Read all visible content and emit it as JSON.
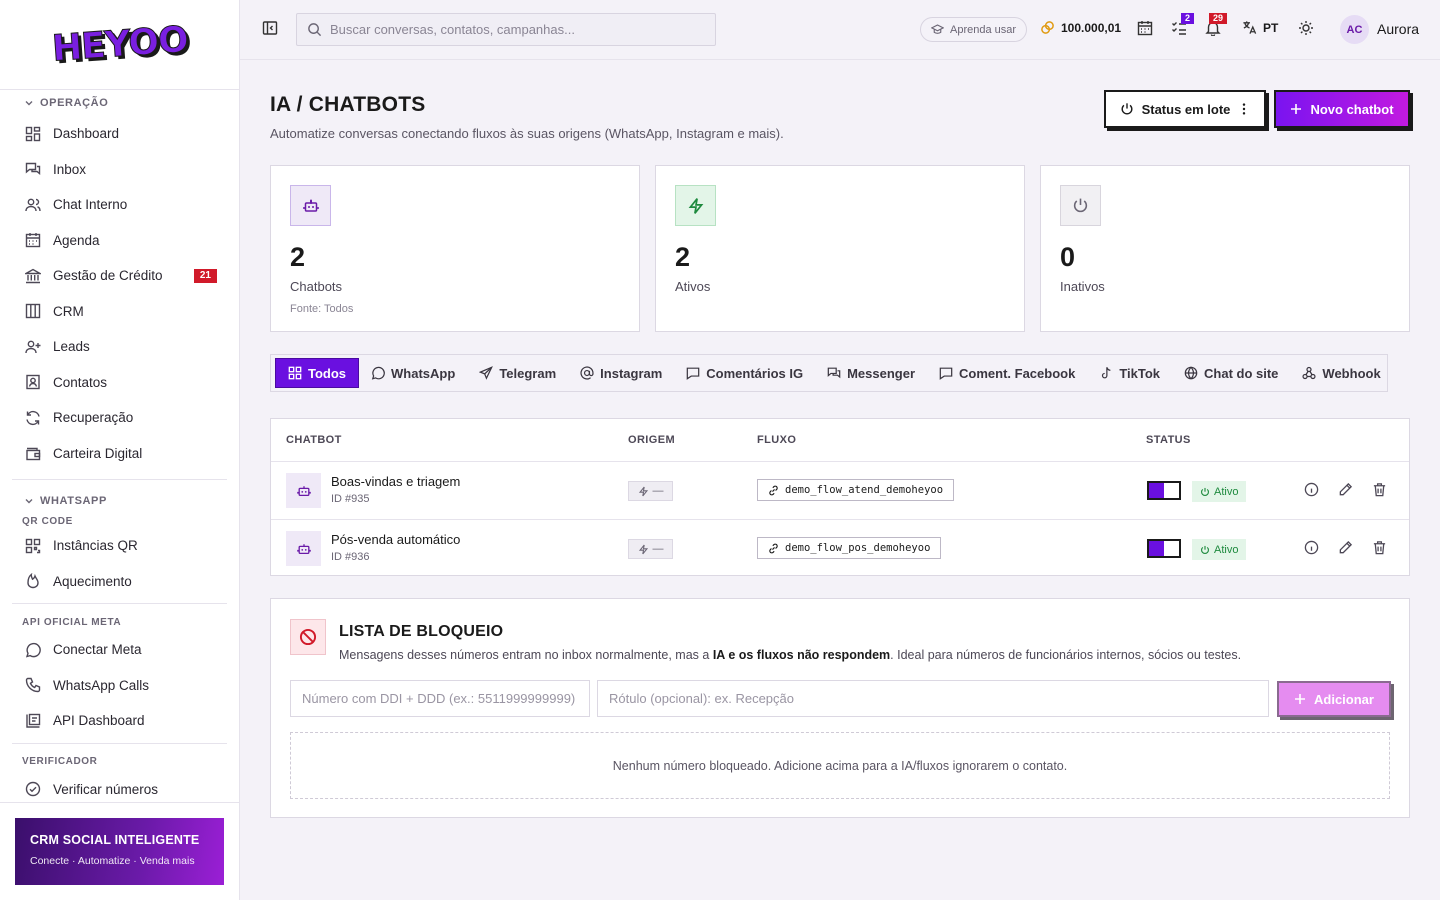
{
  "brand": {
    "logo_text": "HEYOO"
  },
  "sidebar": {
    "sections": [
      {
        "title": "OPERAÇÃO",
        "items": [
          {
            "label": "Dashboard",
            "icon": "grid-icon"
          },
          {
            "label": "Inbox",
            "icon": "chat-bubbles-icon"
          },
          {
            "label": "Chat Interno",
            "icon": "users-icon"
          },
          {
            "label": "Agenda",
            "icon": "calendar-icon"
          },
          {
            "label": "Gestão de Crédito",
            "icon": "bank-icon",
            "badge": "21"
          },
          {
            "label": "CRM",
            "icon": "columns-icon"
          },
          {
            "label": "Leads",
            "icon": "user-plus-icon"
          },
          {
            "label": "Contatos",
            "icon": "contact-card-icon"
          },
          {
            "label": "Recuperação",
            "icon": "refresh-icon"
          },
          {
            "label": "Carteira Digital",
            "icon": "wallet-icon"
          }
        ]
      },
      {
        "title": "WHATSAPP",
        "groups": [
          {
            "subtitle": "QR CODE",
            "items": [
              {
                "label": "Instâncias QR",
                "icon": "qr-icon"
              },
              {
                "label": "Aquecimento",
                "icon": "flame-icon"
              }
            ]
          },
          {
            "subtitle": "API OFICIAL META",
            "items": [
              {
                "label": "Conectar Meta",
                "icon": "whatsapp-icon"
              },
              {
                "label": "WhatsApp Calls",
                "icon": "phone-icon"
              },
              {
                "label": "API Dashboard",
                "icon": "api-dashboard-icon"
              }
            ]
          },
          {
            "subtitle": "VERIFICADOR",
            "items": [
              {
                "label": "Verificar números",
                "icon": "check-circle-icon"
              }
            ]
          }
        ]
      }
    ],
    "promo": {
      "title": "CRM SOCIAL INTELIGENTE",
      "subtitle": "Conecte · Automatize · Venda mais"
    }
  },
  "topbar": {
    "search_placeholder": "Buscar conversas, contatos, campanhas...",
    "learn_label": "Aprenda usar",
    "credits": "100.000,01",
    "tasks_badge": "2",
    "notifications_badge": "29",
    "language": "PT",
    "avatar_initials": "AC",
    "user_name": "Aurora"
  },
  "page": {
    "title": "IA / CHATBOTS",
    "subtitle": "Automatize conversas conectando fluxos às suas origens (WhatsApp, Instagram e mais).",
    "batch_button": "Status em lote",
    "new_button": "Novo chatbot"
  },
  "stats": [
    {
      "value": "2",
      "label": "Chatbots",
      "source": "Fonte: Todos",
      "icon": "robot-icon"
    },
    {
      "value": "2",
      "label": "Ativos",
      "icon": "bolt-icon"
    },
    {
      "value": "0",
      "label": "Inativos",
      "icon": "power-icon"
    }
  ],
  "tabs": [
    {
      "label": "Todos",
      "icon": "grid-icon",
      "active": true
    },
    {
      "label": "WhatsApp",
      "icon": "chat-round-icon"
    },
    {
      "label": "Telegram",
      "icon": "send-icon"
    },
    {
      "label": "Instagram",
      "icon": "at-icon"
    },
    {
      "label": "Comentários IG",
      "icon": "comment-icon"
    },
    {
      "label": "Messenger",
      "icon": "chat-bubbles-icon"
    },
    {
      "label": "Coment. Facebook",
      "icon": "comment-icon"
    },
    {
      "label": "TikTok",
      "icon": "music-note-icon"
    },
    {
      "label": "Chat do site",
      "icon": "globe-icon"
    },
    {
      "label": "Webhook",
      "icon": "webhook-icon"
    }
  ],
  "table": {
    "headers": {
      "chatbot": "CHATBOT",
      "origin": "ORIGEM",
      "flow": "FLUXO",
      "status": "STATUS"
    },
    "rows": [
      {
        "name": "Boas-vindas e triagem",
        "id": "ID #935",
        "origin": "—",
        "flow": "demo_flow_atend_demoheyoo",
        "status": "Ativo"
      },
      {
        "name": "Pós-venda automático",
        "id": "ID #936",
        "origin": "—",
        "flow": "demo_flow_pos_demoheyoo",
        "status": "Ativo"
      }
    ]
  },
  "blocklist": {
    "title": "LISTA DE BLOQUEIO",
    "desc_pre": "Mensagens desses números entram no inbox normalmente, mas a ",
    "desc_bold": "IA e os fluxos não respondem",
    "desc_post": ". Ideal para números de funcionários internos, sócios ou testes.",
    "number_placeholder": "Número com DDI + DDD (ex.: 5511999999999)",
    "label_placeholder": "Rótulo (opcional): ex. Recepção",
    "add_button": "Adicionar",
    "empty_text": "Nenhum número bloqueado. Adicione acima para a IA/fluxos ignorarem o contato."
  },
  "colors": {
    "accent": "#6a10e0",
    "accent_alt": "#c21ae0",
    "danger": "#d11a2a",
    "success": "#1e8a3e"
  }
}
